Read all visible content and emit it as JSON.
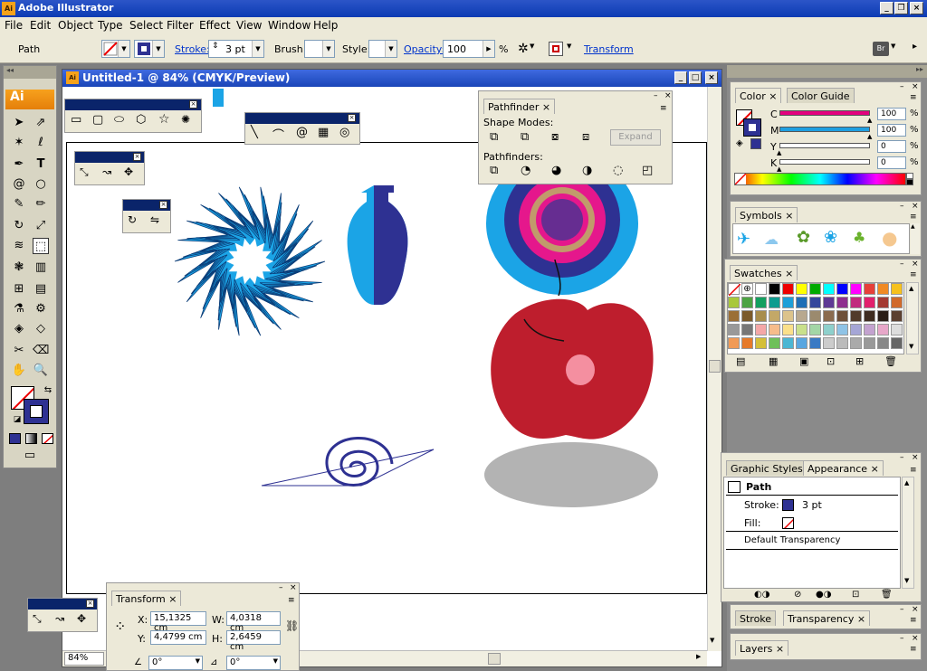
{
  "app": {
    "title": "Adobe Illustrator",
    "icon_text": "Ai"
  },
  "menu": [
    "File",
    "Edit",
    "Object",
    "Type",
    "Select",
    "Filter",
    "Effect",
    "View",
    "Window",
    "Help"
  ],
  "control": {
    "selection": "Path",
    "stroke_label": "Stroke:",
    "stroke_value": "3 pt",
    "brush_label": "Brush:",
    "style_label": "Style:",
    "opacity_label": "Opacity:",
    "opacity_value": "100",
    "percent": "%",
    "transform_label": "Transform",
    "bridge_text": "Br"
  },
  "document": {
    "title": "Untitled-1 @ 84% (CMYK/Preview)",
    "zoom": "84%"
  },
  "pathfinder": {
    "title": "Pathfinder",
    "shape_modes": "Shape Modes:",
    "pathfinders": "Pathfinders:",
    "expand": "Expand"
  },
  "color": {
    "tabs": [
      "Color",
      "Color Guide"
    ],
    "channels": [
      {
        "name": "C",
        "value": "100",
        "color": "#e3007e",
        "fill": 1.0
      },
      {
        "name": "M",
        "value": "100",
        "color": "#1f9fe0",
        "fill": 1.0
      },
      {
        "name": "Y",
        "value": "0",
        "color": "#2a2aa0",
        "fill": 0
      },
      {
        "name": "K",
        "value": "0",
        "color": "#222222",
        "fill": 0
      }
    ],
    "percent": "%"
  },
  "symbols": {
    "tab": "Symbols"
  },
  "swatches": {
    "tab": "Swatches"
  },
  "appearance": {
    "tabs": [
      "Graphic Styles",
      "Appearance"
    ],
    "object": "Path",
    "stroke_label": "Stroke:",
    "stroke_value": "3 pt",
    "fill_label": "Fill:",
    "transparency": "Default Transparency"
  },
  "stroke_panel": {
    "tabs": [
      "Stroke",
      "Transparency"
    ]
  },
  "layers": {
    "tab": "Layers"
  },
  "transform": {
    "tab": "Transform",
    "x_label": "X:",
    "x": "15,1325 cm",
    "y_label": "Y:",
    "y": "4,4799 cm",
    "w_label": "W:",
    "w": "4,0318 cm",
    "h_label": "H:",
    "h": "2,6459 cm",
    "angle1": "0°",
    "angle2": "0°"
  },
  "colors": {
    "accent_blue": "#0a246a",
    "chrome": "#ece9d8",
    "cyan": "#1ba4e6",
    "navy": "#2e3192",
    "apple_red": "#be1e2d",
    "shadow_gray": "#b3b3b3"
  }
}
